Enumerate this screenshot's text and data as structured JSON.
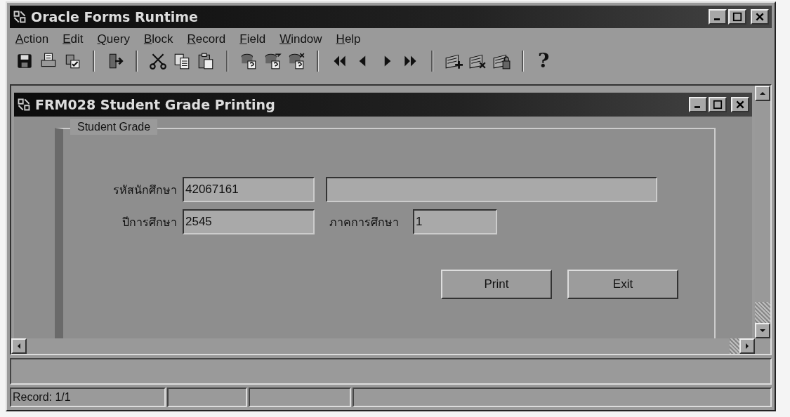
{
  "window": {
    "title": "Oracle Forms Runtime"
  },
  "menu": [
    "Action",
    "Edit",
    "Query",
    "Block",
    "Record",
    "Field",
    "Window",
    "Help"
  ],
  "toolbar": {
    "help_button": "?"
  },
  "form_window": {
    "title": "FRM028 Student Grade Printing"
  },
  "group": {
    "title": "Student Grade",
    "fields": [
      {
        "label": "รหัสนักศึกษา",
        "value": "42067161"
      },
      {
        "label": "ปีการศึกษา",
        "value": "2545"
      },
      {
        "label": "ภาคการศึกษา",
        "value": "1"
      }
    ],
    "buttons": [
      "Print",
      "Exit"
    ]
  },
  "status_bar": {
    "record": "Record: 1/1"
  }
}
